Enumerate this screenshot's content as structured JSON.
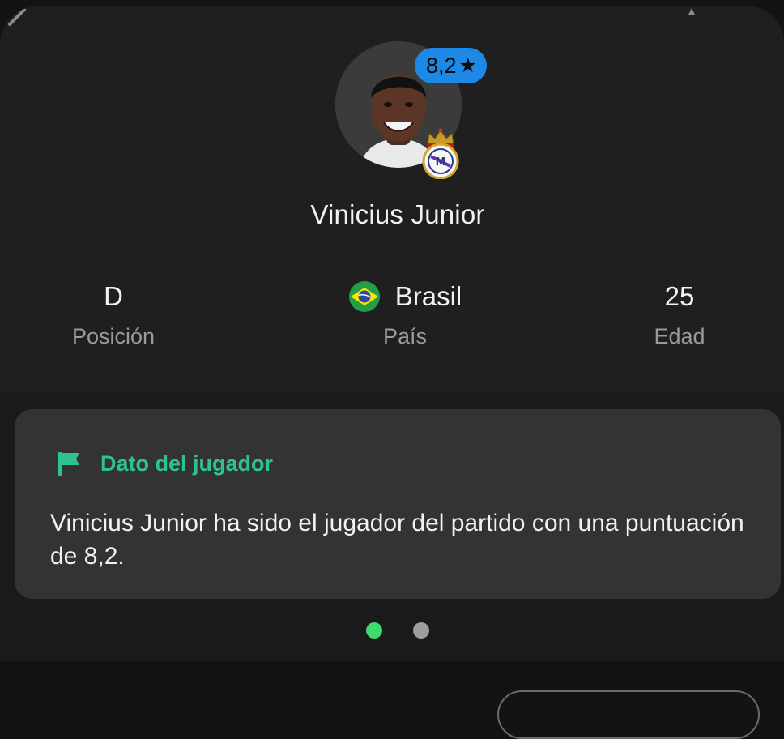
{
  "player": {
    "name": "Vinicius Junior",
    "rating": "8,2",
    "rating_icon": "star-icon",
    "club_crest_icon": "real-madrid-crest-icon"
  },
  "stats": {
    "position": {
      "value": "D",
      "label": "Posición"
    },
    "country": {
      "value": "Brasil",
      "label": "País",
      "flag_icon": "brazil-flag-icon"
    },
    "age": {
      "value": "25",
      "label": "Edad"
    }
  },
  "fact": {
    "title": "Dato del jugador",
    "icon": "flag-icon",
    "body": "Vinicius Junior ha sido el jugador del partido con una puntuación de 8,2."
  },
  "pager": {
    "active_index": 0,
    "total": 2
  },
  "colors": {
    "rating_badge": "#1e88e5",
    "fact_title": "#2ec28f",
    "active_dot": "#3ddc6a",
    "inactive_dot": "#9e9e9e"
  }
}
